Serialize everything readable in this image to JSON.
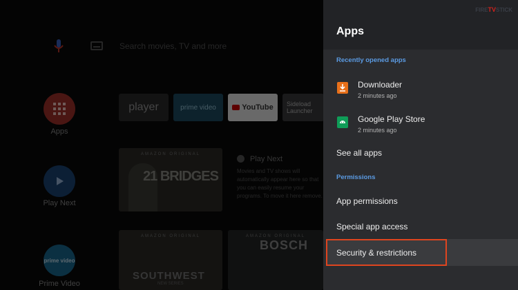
{
  "home": {
    "search_placeholder": "Search movies, TV and more",
    "nav": [
      {
        "label": "Apps",
        "icon": "apps-grid-icon"
      },
      {
        "label": "Play Next",
        "icon": "play-icon"
      },
      {
        "label": "Prime Video",
        "icon": "prime-video-icon"
      }
    ],
    "prime_badge": "prime video",
    "tiles": [
      "player",
      "prime video",
      "YouTube",
      "Sideload Launcher"
    ],
    "play_next": {
      "title": "Play Next",
      "description": "Movies and TV shows will automatically appear here so that you can easily resume your programs. To move it here remove."
    },
    "posters": [
      {
        "tag": "AMAZON ORIGINAL",
        "title": "21 BRIDGES"
      },
      {
        "tag": "AMAZON ORIGINAL",
        "title": "SOUTHWEST",
        "sub": "NEW SERIES"
      },
      {
        "tag": "AMAZON ORIGINAL",
        "title": "BOSCH"
      }
    ]
  },
  "watermark": {
    "left": "FIRE",
    "tv": "TV",
    "right": "STICK"
  },
  "panel": {
    "title": "Apps",
    "recent_section": "Recently opened apps",
    "recent_apps": [
      {
        "name": "Downloader",
        "time": "2 minutes ago",
        "icon": "download-icon",
        "color": "#e8701a"
      },
      {
        "name": "Google Play Store",
        "time": "2 minutes ago",
        "icon": "android-icon",
        "color": "#0f9d58"
      }
    ],
    "see_all": "See all apps",
    "permissions_section": "Permissions",
    "app_permissions": "App permissions",
    "special_access": "Special app access",
    "security": "Security & restrictions",
    "accent_color": "#5b9be3",
    "highlight_color": "#e0451f"
  }
}
